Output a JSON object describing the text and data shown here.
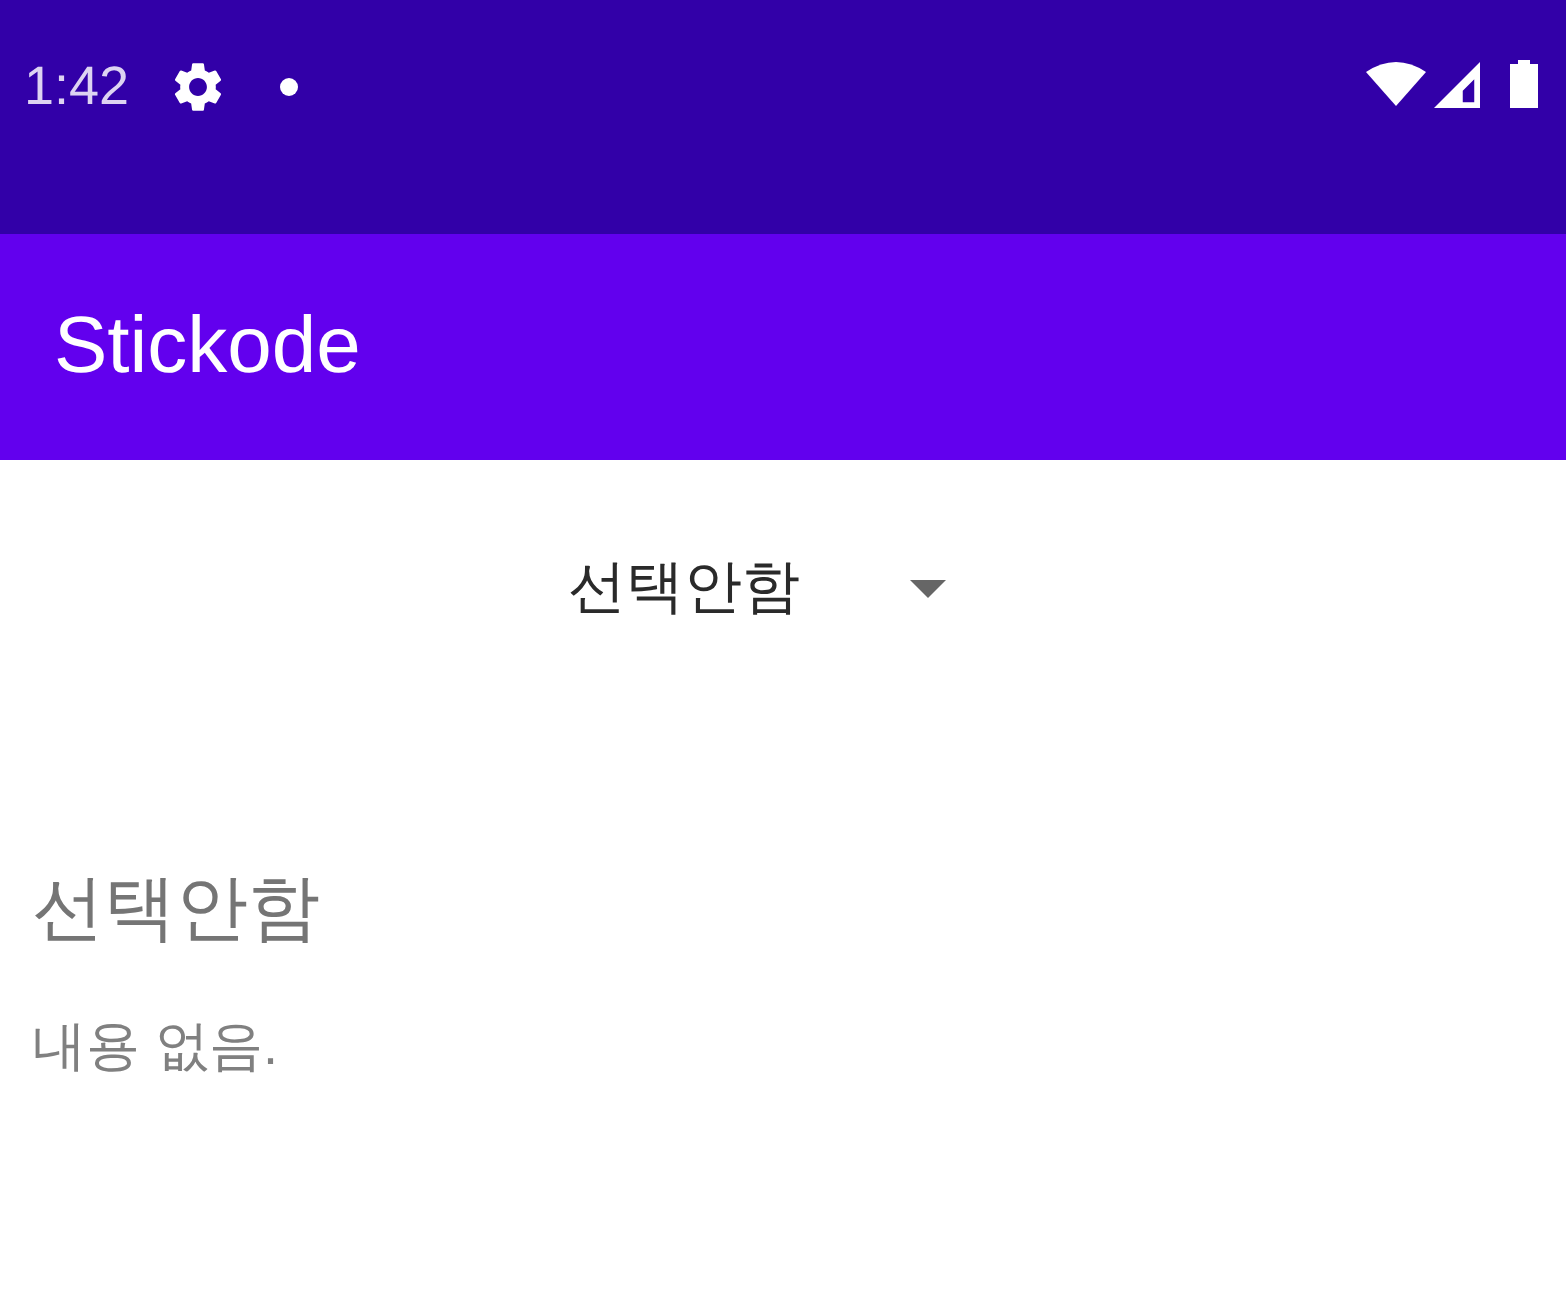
{
  "status_bar": {
    "time": "1:42"
  },
  "app_bar": {
    "title": "Stickode"
  },
  "dropdown": {
    "value": "선택안함"
  },
  "content": {
    "title": "선택안함",
    "text": "내용 없음."
  }
}
